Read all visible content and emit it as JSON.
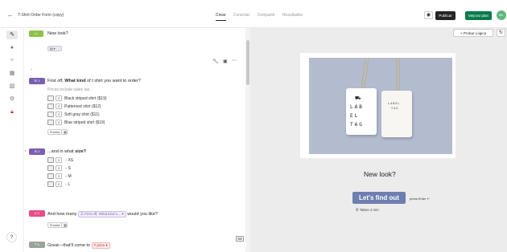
{
  "topbar": {
    "back_icon": "arrow-left-icon",
    "form_name": "T-Shirt Order Form (copy)",
    "tabs": [
      "Crear",
      "Conectar",
      "Compartir",
      "Resultados"
    ],
    "publish_label": "Publicar",
    "upgrade_label": "Mejorar plan",
    "user_initials": "KL"
  },
  "leftbar": {
    "icons": [
      "pencil-icon",
      "drop-icon",
      "branch-icon",
      "calculator-icon",
      "image-icon",
      "gear-icon",
      "lock-icon"
    ],
    "help_label": "?"
  },
  "editor": {
    "welcome": {
      "num": "",
      "text": "New look?"
    },
    "q1": {
      "num": "1",
      "text_prefix": "First off, ",
      "text_bold": "What kind",
      "text_suffix": " of t shirt you want to order?",
      "note": "Prices include sales tax.",
      "choices": [
        "Black striped shirt ($19)",
        "Patterned shirt ($12)",
        "Soft gray shirt ($11)",
        "Blue striped shirt ($19)"
      ],
      "tag_label": "Prueba"
    },
    "q2": {
      "num": "2",
      "text_prefix": "...and in what ",
      "text_bold": "size?",
      "choices": [
        "XS",
        "S",
        "M",
        "L"
      ]
    },
    "q3": {
      "num": "3",
      "text_prefix": "And how many ",
      "ref_chip": "First off, What kind o...",
      "text_suffix": " would you like?",
      "tag_label": "Prueba"
    },
    "q4": {
      "num": "4",
      "text_prefix": "Great—that'll come to ",
      "price_chip": "price"
    }
  },
  "preview": {
    "logic_label": "Probar Lógica",
    "tag1_text": [
      "LAB",
      "EL",
      "TAG"
    ],
    "tag2_text": [
      "LABEL",
      "TAG"
    ],
    "question": "New look?",
    "cta_label": "Let's find out",
    "press_hint": "press Enter ↵",
    "takes_label": "Takes 4 min"
  },
  "colors": {
    "accent_purple": "#7a5fb1",
    "welcome_green": "#8bc34a",
    "q3_pink": "#e84b8a",
    "q4_gray": "#9aa59a",
    "cta_blue": "#6e7faf",
    "upgrade_green": "#0b7a4a"
  }
}
